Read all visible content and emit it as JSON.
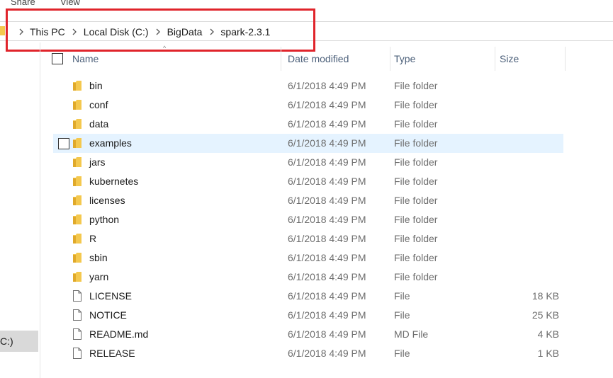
{
  "ribbon": {
    "share_label": "Share",
    "view_label": "View"
  },
  "address": {
    "crumbs": [
      "This PC",
      "Local Disk (C:)",
      "BigData",
      "spark-2.3.1"
    ]
  },
  "nav": {
    "selected_label": "C:)"
  },
  "columns": {
    "name": "Name",
    "date": "Date modified",
    "type": "Type",
    "size": "Size"
  },
  "files": [
    {
      "name": "bin",
      "date": "6/1/2018 4:49 PM",
      "type": "File folder",
      "size": "",
      "icon": "folder-icon"
    },
    {
      "name": "conf",
      "date": "6/1/2018 4:49 PM",
      "type": "File folder",
      "size": "",
      "icon": "folder-icon"
    },
    {
      "name": "data",
      "date": "6/1/2018 4:49 PM",
      "type": "File folder",
      "size": "",
      "icon": "folder-icon"
    },
    {
      "name": "examples",
      "date": "6/1/2018 4:49 PM",
      "type": "File folder",
      "size": "",
      "icon": "folder-icon"
    },
    {
      "name": "jars",
      "date": "6/1/2018 4:49 PM",
      "type": "File folder",
      "size": "",
      "icon": "folder-icon"
    },
    {
      "name": "kubernetes",
      "date": "6/1/2018 4:49 PM",
      "type": "File folder",
      "size": "",
      "icon": "folder-icon"
    },
    {
      "name": "licenses",
      "date": "6/1/2018 4:49 PM",
      "type": "File folder",
      "size": "",
      "icon": "folder-icon"
    },
    {
      "name": "python",
      "date": "6/1/2018 4:49 PM",
      "type": "File folder",
      "size": "",
      "icon": "folder-icon"
    },
    {
      "name": "R",
      "date": "6/1/2018 4:49 PM",
      "type": "File folder",
      "size": "",
      "icon": "folder-icon"
    },
    {
      "name": "sbin",
      "date": "6/1/2018 4:49 PM",
      "type": "File folder",
      "size": "",
      "icon": "folder-icon"
    },
    {
      "name": "yarn",
      "date": "6/1/2018 4:49 PM",
      "type": "File folder",
      "size": "",
      "icon": "folder-icon"
    },
    {
      "name": "LICENSE",
      "date": "6/1/2018 4:49 PM",
      "type": "File",
      "size": "18 KB",
      "icon": "file-icon"
    },
    {
      "name": "NOTICE",
      "date": "6/1/2018 4:49 PM",
      "type": "File",
      "size": "25 KB",
      "icon": "file-icon"
    },
    {
      "name": "README.md",
      "date": "6/1/2018 4:49 PM",
      "type": "MD File",
      "size": "4 KB",
      "icon": "file-icon"
    },
    {
      "name": "RELEASE",
      "date": "6/1/2018 4:49 PM",
      "type": "File",
      "size": "1 KB",
      "icon": "file-icon"
    }
  ],
  "colors": {
    "folder": "#f4c84e",
    "highlight": "#e0242b",
    "hover_row": "#e5f3ff",
    "header_text": "#4c607a"
  }
}
